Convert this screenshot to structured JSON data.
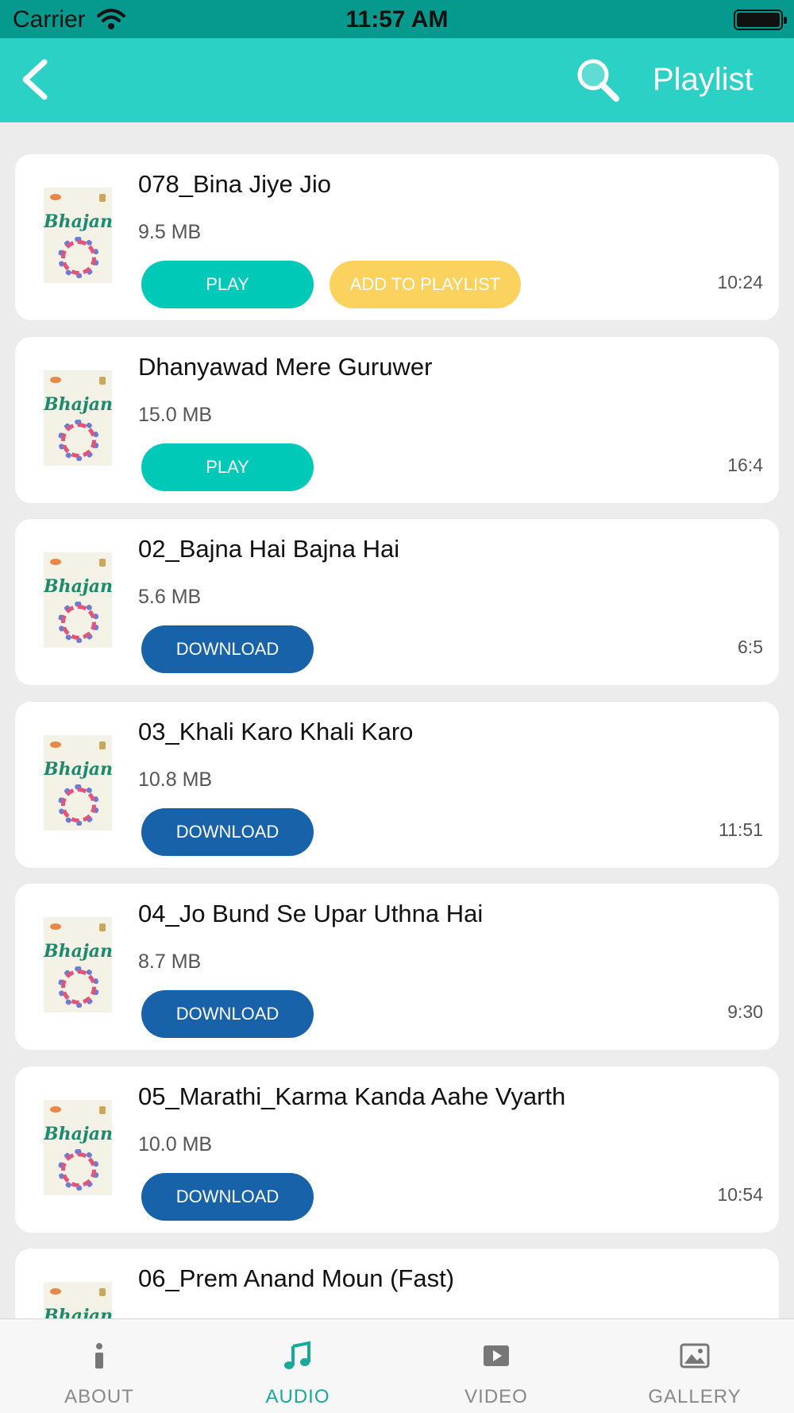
{
  "status_bar": {
    "carrier": "Carrier",
    "time": "11:57 AM"
  },
  "nav": {
    "title": "Playlist"
  },
  "colors": {
    "accent": "#2ad1c4",
    "play": "#00c9b8",
    "add_to_playlist": "#fbd25e",
    "download": "#1762a8",
    "tab_active": "#18a99a"
  },
  "thumbnail": {
    "text": "Bhajan"
  },
  "songs": [
    {
      "title": "078_Bina Jiye Jio",
      "size": "9.5 MB",
      "primary_action": "PLAY",
      "secondary_action": "ADD TO PLAYLIST",
      "duration": "10:24"
    },
    {
      "title": "Dhanyawad Mere Guruwer",
      "size": "15.0 MB",
      "primary_action": "PLAY",
      "duration": "16:4"
    },
    {
      "title": "02_Bajna Hai Bajna Hai",
      "size": "5.6 MB",
      "primary_action": "DOWNLOAD",
      "duration": "6:5"
    },
    {
      "title": "03_Khali Karo Khali Karo",
      "size": "10.8 MB",
      "primary_action": "DOWNLOAD",
      "duration": "11:51"
    },
    {
      "title": "04_Jo Bund Se Upar Uthna Hai",
      "size": "8.7 MB",
      "primary_action": "DOWNLOAD",
      "duration": "9:30"
    },
    {
      "title": "05_Marathi_Karma Kanda Aahe Vyarth",
      "size": "10.0 MB",
      "primary_action": "DOWNLOAD",
      "duration": "10:54"
    },
    {
      "title": "06_Prem Anand Moun (Fast)"
    }
  ],
  "tabs": [
    {
      "label": "ABOUT",
      "icon": "info-icon"
    },
    {
      "label": "AUDIO",
      "icon": "music-note-icon",
      "active": true
    },
    {
      "label": "VIDEO",
      "icon": "video-play-icon"
    },
    {
      "label": "GALLERY",
      "icon": "image-icon"
    }
  ]
}
